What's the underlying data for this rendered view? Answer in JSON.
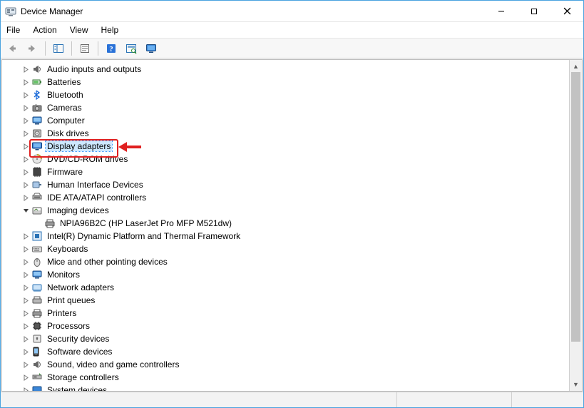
{
  "window": {
    "title": "Device Manager"
  },
  "menu": {
    "items": [
      "File",
      "Action",
      "View",
      "Help"
    ]
  },
  "toolbar": {
    "buttons": [
      {
        "name": "back-icon"
      },
      {
        "name": "forward-icon"
      },
      {
        "name": "show-hide-tree-icon"
      },
      {
        "name": "properties-icon"
      },
      {
        "name": "help-icon"
      },
      {
        "name": "scan-hardware-icon"
      },
      {
        "name": "monitor-icon"
      }
    ]
  },
  "tree": {
    "highlighted_index": 6,
    "items": [
      {
        "label": "Audio inputs and outputs",
        "icon": "speaker-icon",
        "expander": ">",
        "indent": 0
      },
      {
        "label": "Batteries",
        "icon": "battery-icon",
        "expander": ">",
        "indent": 0
      },
      {
        "label": "Bluetooth",
        "icon": "bluetooth-icon",
        "expander": ">",
        "indent": 0
      },
      {
        "label": "Cameras",
        "icon": "camera-icon",
        "expander": ">",
        "indent": 0
      },
      {
        "label": "Computer",
        "icon": "computer-icon",
        "expander": ">",
        "indent": 0
      },
      {
        "label": "Disk drives",
        "icon": "disk-icon",
        "expander": ">",
        "indent": 0
      },
      {
        "label": "Display adapters",
        "icon": "display-icon",
        "expander": ">",
        "indent": 0,
        "selected": true
      },
      {
        "label": "DVD/CD-ROM drives",
        "icon": "cdrom-icon",
        "expander": ">",
        "indent": 0
      },
      {
        "label": "Firmware",
        "icon": "firmware-icon",
        "expander": ">",
        "indent": 0
      },
      {
        "label": "Human Interface Devices",
        "icon": "hid-icon",
        "expander": ">",
        "indent": 0
      },
      {
        "label": "IDE ATA/ATAPI controllers",
        "icon": "ide-icon",
        "expander": ">",
        "indent": 0
      },
      {
        "label": "Imaging devices",
        "icon": "imaging-icon",
        "expander": "v",
        "indent": 0
      },
      {
        "label": "NPIA96B2C (HP LaserJet Pro MFP M521dw)",
        "icon": "printer-device-icon",
        "expander": "",
        "indent": 1
      },
      {
        "label": "Intel(R) Dynamic Platform and Thermal Framework",
        "icon": "intel-icon",
        "expander": ">",
        "indent": 0
      },
      {
        "label": "Keyboards",
        "icon": "keyboard-icon",
        "expander": ">",
        "indent": 0
      },
      {
        "label": "Mice and other pointing devices",
        "icon": "mouse-icon",
        "expander": ">",
        "indent": 0
      },
      {
        "label": "Monitors",
        "icon": "monitor-icon",
        "expander": ">",
        "indent": 0
      },
      {
        "label": "Network adapters",
        "icon": "network-icon",
        "expander": ">",
        "indent": 0
      },
      {
        "label": "Print queues",
        "icon": "printqueue-icon",
        "expander": ">",
        "indent": 0
      },
      {
        "label": "Printers",
        "icon": "printer-icon",
        "expander": ">",
        "indent": 0
      },
      {
        "label": "Processors",
        "icon": "processor-icon",
        "expander": ">",
        "indent": 0
      },
      {
        "label": "Security devices",
        "icon": "security-icon",
        "expander": ">",
        "indent": 0
      },
      {
        "label": "Software devices",
        "icon": "software-icon",
        "expander": ">",
        "indent": 0
      },
      {
        "label": "Sound, video and game controllers",
        "icon": "sound-icon",
        "expander": ">",
        "indent": 0
      },
      {
        "label": "Storage controllers",
        "icon": "storage-icon",
        "expander": ">",
        "indent": 0
      },
      {
        "label": "System devices",
        "icon": "system-icon",
        "expander": ">",
        "indent": 0
      }
    ]
  }
}
